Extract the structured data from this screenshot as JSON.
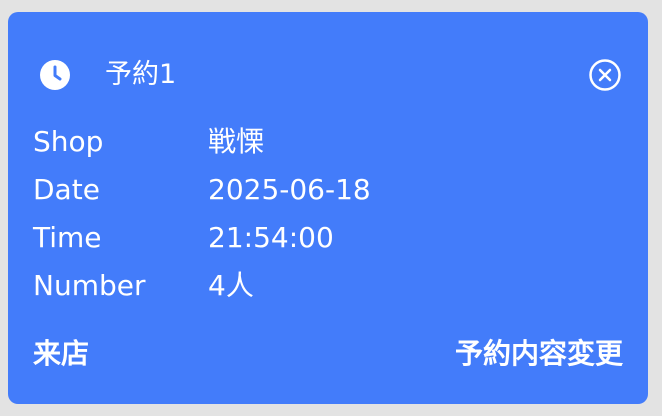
{
  "card": {
    "title": "予約1",
    "close_icon": "close-circle-icon",
    "clock_icon": "clock-icon",
    "accent": "#437cfa"
  },
  "details": [
    {
      "label": "Shop",
      "value": "戦慄"
    },
    {
      "label": "Date",
      "value": "2025-06-18"
    },
    {
      "label": "Time",
      "value": "21:54:00"
    },
    {
      "label": "Number",
      "value": "4人"
    }
  ],
  "actions": {
    "left": "来店",
    "right": "予約内容変更"
  }
}
